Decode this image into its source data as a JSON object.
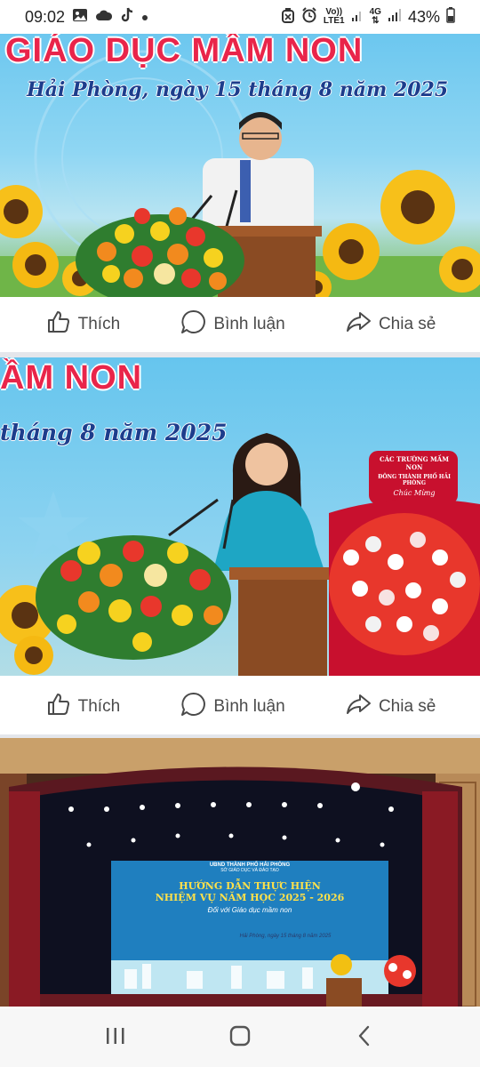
{
  "status_bar": {
    "time": "09:02",
    "network_top": "Vo))",
    "network_bottom": "LTE1",
    "net_type": "4G",
    "battery": "43%",
    "icons": [
      "image-icon",
      "cloud-icon",
      "tiktok-icon",
      "dot-icon",
      "alarm-off-icon",
      "alarm-icon",
      "signal-icon",
      "battery-icon"
    ]
  },
  "post1": {
    "banner_title": "GIÁO DỤC MẦM NON",
    "banner_subtitle": "Hải Phòng, ngày 15 tháng 8 năm 2025"
  },
  "post2": {
    "banner_title": "ẦM NON",
    "banner_subtitle": "tháng 8 năm 2025",
    "flower_card_line1": "CÁC TRƯỜNG MẦM NON",
    "flower_card_line2": "ĐÔNG THÀNH PHỐ HẢI PHÒNG",
    "flower_card_line3": "Chúc Mừng"
  },
  "post3": {
    "screen_org_line1": "UBND THÀNH PHỐ HẢI PHÒNG",
    "screen_org_line2": "SỞ GIÁO DỤC VÀ ĐÀO TẠO",
    "screen_title_line1": "HƯỚNG DẪN THỰC HIỆN",
    "screen_title_line2": "NHIỆM VỤ NĂM HỌC 2025 - 2026",
    "screen_title_line3": "Đối với Giáo dục mầm non",
    "screen_date": "Hải Phòng, ngày 15 tháng 8 năm 2025"
  },
  "actions": {
    "like": "Thích",
    "comment": "Bình luận",
    "share": "Chia sẻ"
  },
  "colors": {
    "banner_red": "#e9254a",
    "banner_blue": "#1d3d8c",
    "action_text": "#4a4a4a"
  }
}
